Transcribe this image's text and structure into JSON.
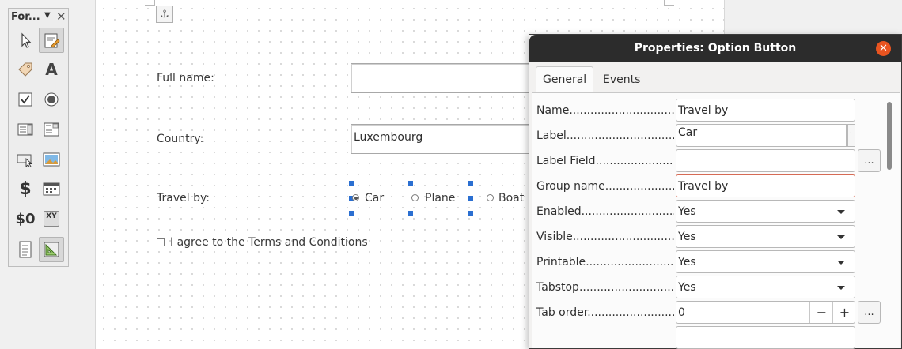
{
  "toolbar": {
    "title": "For...",
    "tools": [
      {
        "name": "select-icon",
        "pressed": false
      },
      {
        "name": "design-mode-icon",
        "pressed": true
      },
      {
        "name": "label-tag-icon",
        "pressed": false
      },
      {
        "name": "text-box-icon",
        "pressed": false
      },
      {
        "name": "checkbox-icon",
        "pressed": false
      },
      {
        "name": "option-button-icon",
        "pressed": false
      },
      {
        "name": "list-box-icon",
        "pressed": false
      },
      {
        "name": "combo-box-icon",
        "pressed": false
      },
      {
        "name": "push-button-icon",
        "pressed": false
      },
      {
        "name": "image-button-icon",
        "pressed": false
      },
      {
        "name": "formatted-field-icon",
        "pressed": false
      },
      {
        "name": "date-field-icon",
        "pressed": false
      },
      {
        "name": "numeric-field-icon",
        "pressed": false
      },
      {
        "name": "pattern-field-icon",
        "pressed": false
      },
      {
        "name": "form-properties-icon",
        "pressed": false
      },
      {
        "name": "form-design-icon",
        "pressed": true
      }
    ],
    "currency_glyph": "$",
    "numeric_glyph": "$0",
    "pattern_glyph": "XY",
    "text_glyph": "A"
  },
  "form": {
    "full_name_label": "Full name:",
    "full_name_value": "",
    "country_label": "Country:",
    "country_value": "Luxembourg",
    "travel_label": "Travel by:",
    "options": [
      "Car",
      "Plane",
      "Boat"
    ],
    "selected_option": "Car",
    "terms_label": "I agree to the Terms and Conditions",
    "terms_checked": false
  },
  "dialog": {
    "title": "Properties: Option Button",
    "tabs": [
      "General",
      "Events"
    ],
    "active_tab": "General",
    "properties": [
      {
        "label": "Name",
        "value": "Travel by"
      },
      {
        "label": "Label",
        "value": "Car"
      },
      {
        "label": "Label Field",
        "value": ""
      },
      {
        "label": "Group name",
        "value": "Travel by"
      },
      {
        "label": "Enabled",
        "value": "Yes"
      },
      {
        "label": "Visible",
        "value": "Yes"
      },
      {
        "label": "Printable",
        "value": "Yes"
      },
      {
        "label": "Tabstop",
        "value": "Yes"
      },
      {
        "label": "Tab order",
        "value": "0"
      }
    ],
    "leader": "........................................",
    "dots_button": "...",
    "minus": "−",
    "plus": "+"
  },
  "colors": {
    "selection_handle": "#2b6fd1",
    "close_button": "#e95420",
    "titlebar": "#2c2c2c",
    "focus_border": "#d66b55"
  }
}
